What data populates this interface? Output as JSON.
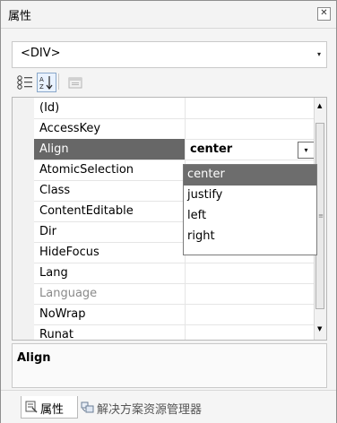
{
  "window": {
    "title": "属性",
    "close_glyph": "✕"
  },
  "selector": {
    "value": "<DIV>",
    "arrow": "▾"
  },
  "toolbar": {
    "categorized_icon": "categorized-icon",
    "alphabetical_icon": "alphabetical-icon",
    "property_pages_icon": "property-pages-icon"
  },
  "grid": {
    "rows": [
      {
        "name": "(Id)",
        "value": ""
      },
      {
        "name": "AccessKey",
        "value": ""
      },
      {
        "name": "Align",
        "value": "center",
        "selected": true
      },
      {
        "name": "AtomicSelection",
        "value": ""
      },
      {
        "name": "Class",
        "value": ""
      },
      {
        "name": "ContentEditable",
        "value": ""
      },
      {
        "name": "Dir",
        "value": ""
      },
      {
        "name": "HideFocus",
        "value": ""
      },
      {
        "name": "Lang",
        "value": ""
      },
      {
        "name": "Language",
        "value": "",
        "disabled": true
      },
      {
        "name": "NoWrap",
        "value": ""
      },
      {
        "name": "Runat",
        "value": ""
      }
    ],
    "dropdown_glyph": "▾"
  },
  "dropdown": {
    "options": [
      "center",
      "justify",
      "left",
      "right"
    ],
    "highlighted": "center"
  },
  "scrollbar": {
    "up": "▲",
    "down": "▼",
    "grip": "≡"
  },
  "description": {
    "title": "Align"
  },
  "tabs": [
    {
      "label": "属性",
      "icon": "properties-icon",
      "active": true
    },
    {
      "label": "解决方案资源管理器",
      "icon": "solution-explorer-icon",
      "active": false
    }
  ]
}
